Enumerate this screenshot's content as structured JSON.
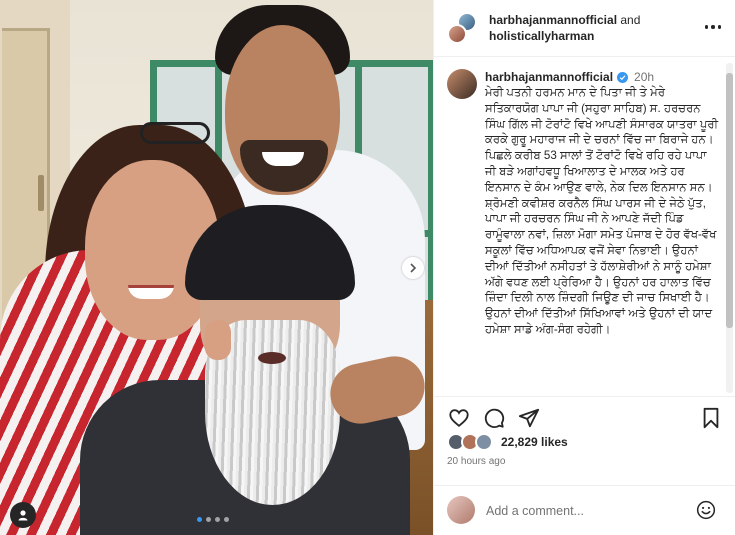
{
  "header": {
    "user1": "harbhajanmannofficial",
    "joiner": " and",
    "user2": "holisticallyharman"
  },
  "caption": {
    "username": "harbhajanmannofficial",
    "time": "20h",
    "text": "ਮੇਰੀ ਪਤਨੀ ਹਰਮਨ ਮਾਨ ਦੇ ਪਿਤਾ ਜੀ ਤੇ ਮੇਰੇ ਸਤਿਕਾਰਯੋਗ ਪਾਪਾ ਜੀ (ਸਹੁਰਾ ਸਾਹਿਬ) ਸ. ਹਰਚਰਨ ਸਿੰਘ ਗਿੱਲ ਜੀ ਟੋਰਾਂਟੋ ਵਿਖੇ ਆਪਣੀ ਸੰਸਾਰਕ ਯਾਤਰਾ ਪੂਰੀ ਕਰਕੇ ਗੁਰੂ ਮਹਾਰਾਜ ਜੀ ਦੇ ਚਰਨਾਂ ਵਿੱਚ ਜਾ ਬਿਰਾਜੇ ਹਨ।\nਪਿਛਲੇ ਕਰੀਬ 53 ਸਾਲਾਂ ਤੋਂ ਟੋਰਾਂਟੋ ਵਿਖੇ ਰਹਿ ਰਹੇ ਪਾਪਾ ਜੀ ਬੜੇ ਅਗਾਂਹਵਧੂ ਖਿਆਲਾਤ ਦੇ ਮਾਲਕ ਅਤੇ ਹਰ ਇਨਸਾਨ ਦੇ ਕੰਮ ਆਉਣ ਵਾਲੇ, ਨੇਕ ਦਿਲ ਇਨਸਾਨ ਸਨ।\nਸ਼੍ਰੋਮਣੀ ਕਵੀਸ਼ਰ ਕਰਨੈਲ ਸਿੰਘ ਪਾਰਸ ਜੀ ਦੇ ਜੇਠੇ ਪੁੱਤ, ਪਾਪਾ ਜੀ ਹਰਚਰਨ ਸਿੰਘ ਜੀ ਨੇ ਆਪਣੇ ਜੱਦੀ ਪਿੰਡ ਰਾਮੂੰਵਾਲਾ ਨਵਾਂ, ਜ਼ਿਲਾ ਮੋਗਾ ਸਮੇਤ ਪੰਜਾਬ ਦੇ ਹੋਰ ਵੱਖ-ਵੱਖ ਸਕੂਲਾਂ ਵਿੱਚ ਅਧਿਆਪਕ ਵਜੋਂ ਸੇਵਾ ਨਿਭਾਈ। ਉਹਨਾਂ ਦੀਆਂ ਦਿੱਤੀਆਂ ਨਸੀਹਤਾਂ ਤੇ ਹੱਲਾਸ਼ੇਰੀਆਂ ਨੇ ਸਾਨੂੰ ਹਮੇਸ਼ਾ ਅੱਗੇ ਵਧਣ ਲਈ ਪ੍ਰੇਰਿਆ ਹੈ। ਉਹਨਾਂ ਹਰ ਹਾਲਾਤ ਵਿੱਚ ਜ਼ਿੰਦਾ ਦਿਲੀ ਨਾਲ ਜ਼ਿੰਦਗੀ ਜਿਊਣ ਦੀ ਜਾਚ ਸਿਖਾਈ ਹੈ। ਉਹਨਾਂ ਦੀਆਂ ਦਿੱਤੀਆਂ ਸਿੱਖਿਆਵਾਂ ਅਤੇ ਉਹਨਾਂ ਦੀ ਯਾਦ ਹਮੇਸ਼ਾ ਸਾਡੇ ਅੰਗ-ਸੰਗ ਰਹੇਗੀ।"
  },
  "stats": {
    "likes": "22,829 likes",
    "posted": "20 hours ago"
  },
  "comment": {
    "placeholder": "Add a comment..."
  },
  "carousel": {
    "total": 4,
    "current": 1
  },
  "icons": {
    "like": "heart-icon",
    "comment": "comment-icon",
    "share": "send-icon",
    "save": "bookmark-icon",
    "more": "more-icon",
    "emoji": "emoji-icon",
    "tag": "person-tag-icon",
    "next": "chevron-right-icon"
  },
  "colors": {
    "verified": "#3897f0",
    "text": "#262626",
    "muted": "#737373"
  }
}
